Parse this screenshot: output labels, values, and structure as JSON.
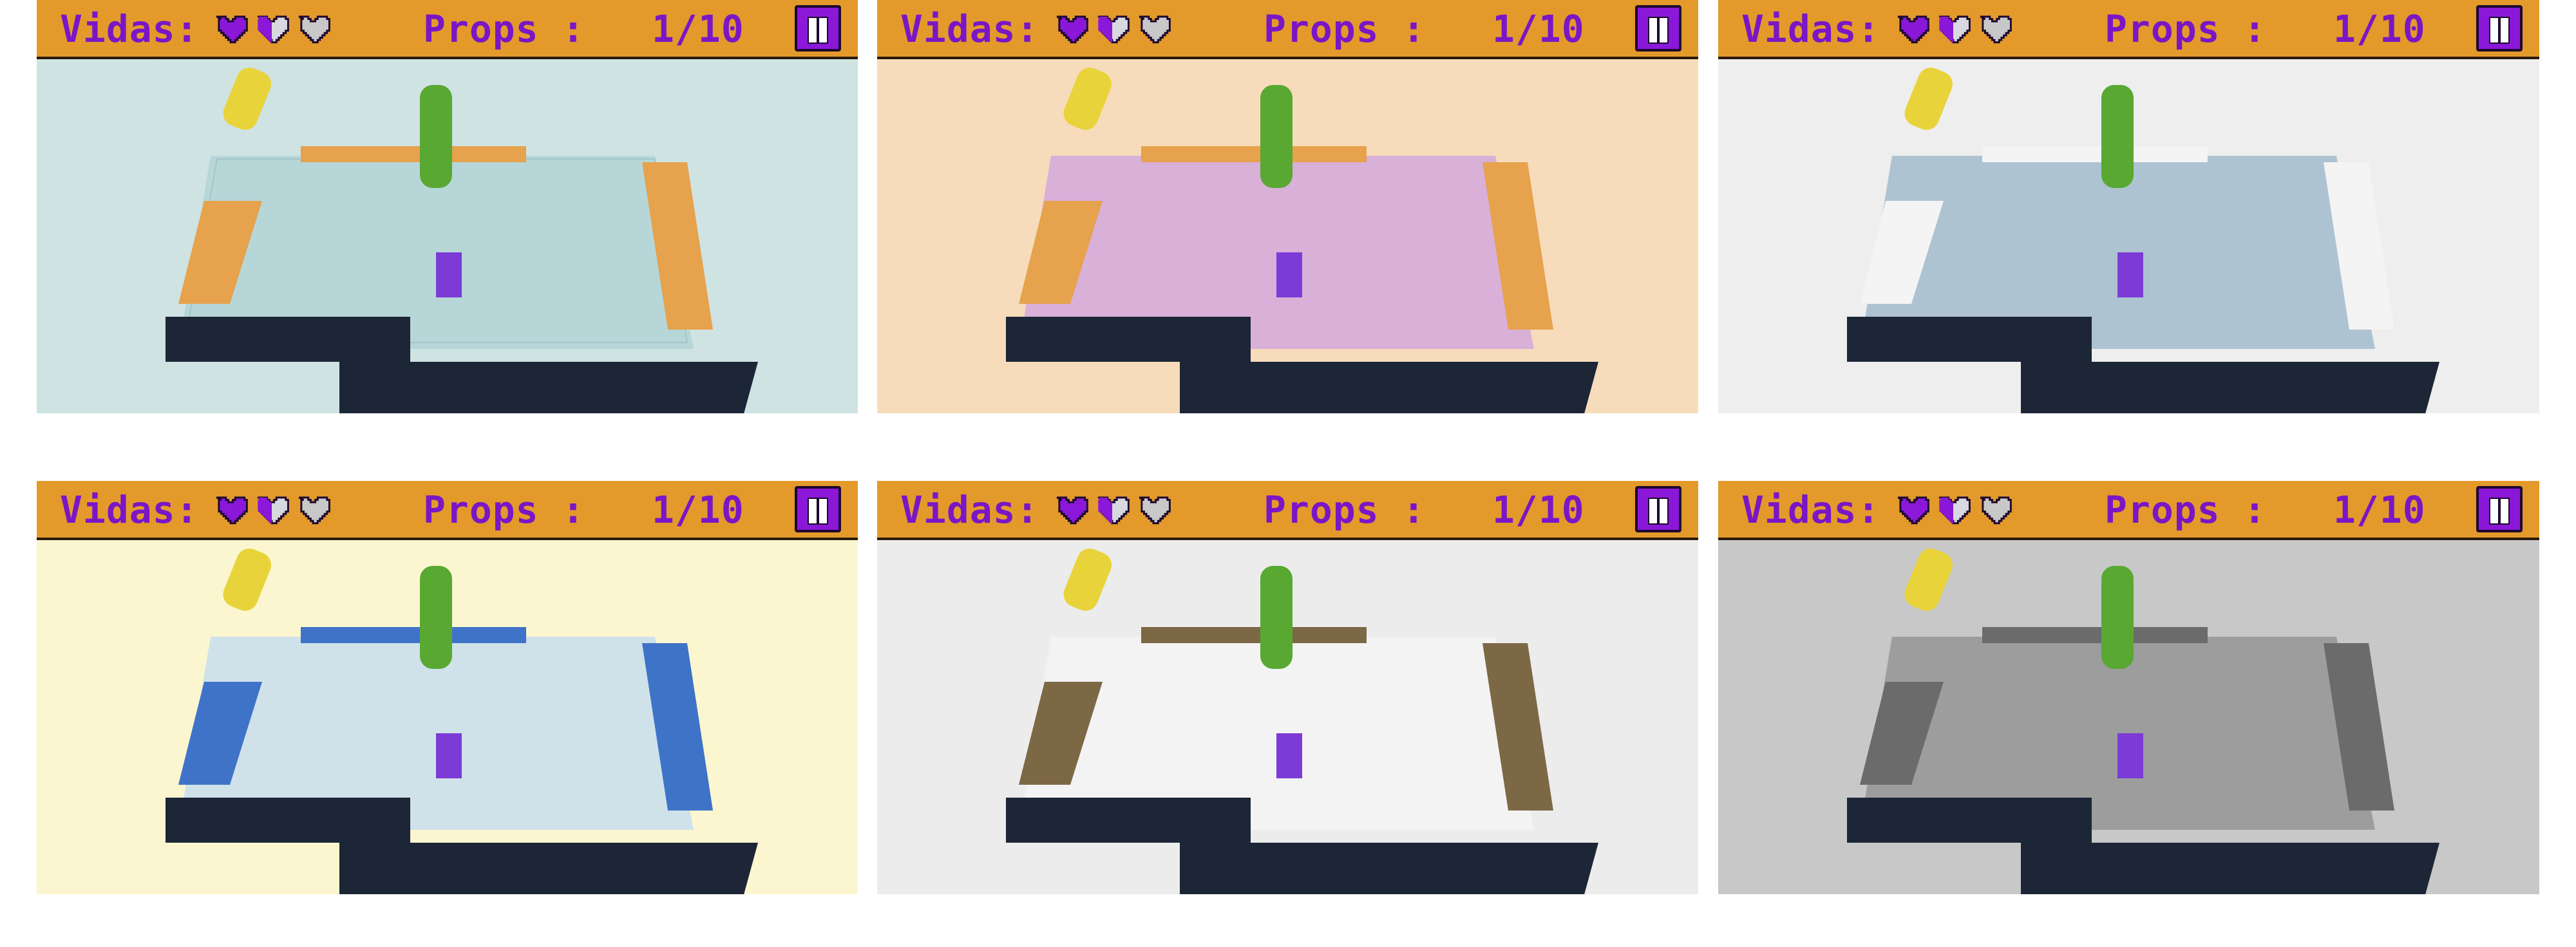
{
  "hud": {
    "lives_label": "Vidas:",
    "props_label": "Props :",
    "props_value": "1/10",
    "lives_state": [
      "full",
      "half",
      "empty"
    ]
  },
  "panels": [
    {
      "theme": "teal",
      "colors": {
        "wall": "#cfe3e3",
        "floor": "#b7d6d8",
        "table": "#e6a24c",
        "outside": "#9fc8c4"
      }
    },
    {
      "theme": "peach",
      "colors": {
        "wall": "#f7dcbc",
        "floor": "#d8b0d8",
        "table": "#e6a24c",
        "outside": "#c9a0d6"
      }
    },
    {
      "theme": "white",
      "colors": {
        "wall": "#eeeeee",
        "floor": "#aec3d2",
        "table": "#f4f4f4",
        "outside": "#c7d6e2"
      }
    },
    {
      "theme": "yellow",
      "colors": {
        "wall": "#fbf6cf",
        "floor": "#cfe2ea",
        "table": "#3f73c8",
        "outside": "#cfe2ea"
      }
    },
    {
      "theme": "light",
      "colors": {
        "wall": "#ececec",
        "floor": "#f3f3f3",
        "table": "#7d6846",
        "outside": "#e2e2e2"
      }
    },
    {
      "theme": "grayscale",
      "colors": {
        "wall": "#c8c8c8",
        "floor": "#9d9d9d",
        "table": "#6b6b6b",
        "outside": "#a8a8a8"
      }
    }
  ],
  "colors": {
    "hud_bg": "#e39a2b",
    "hud_text": "#7a16c6",
    "heart": "#8b18d8",
    "heart_empty": "#c8c8c8",
    "pause_bg": "#8b18d8",
    "pipe_yellow": "#e8d43a",
    "pipe_green": "#58a832",
    "conveyor": "#1c2636"
  }
}
